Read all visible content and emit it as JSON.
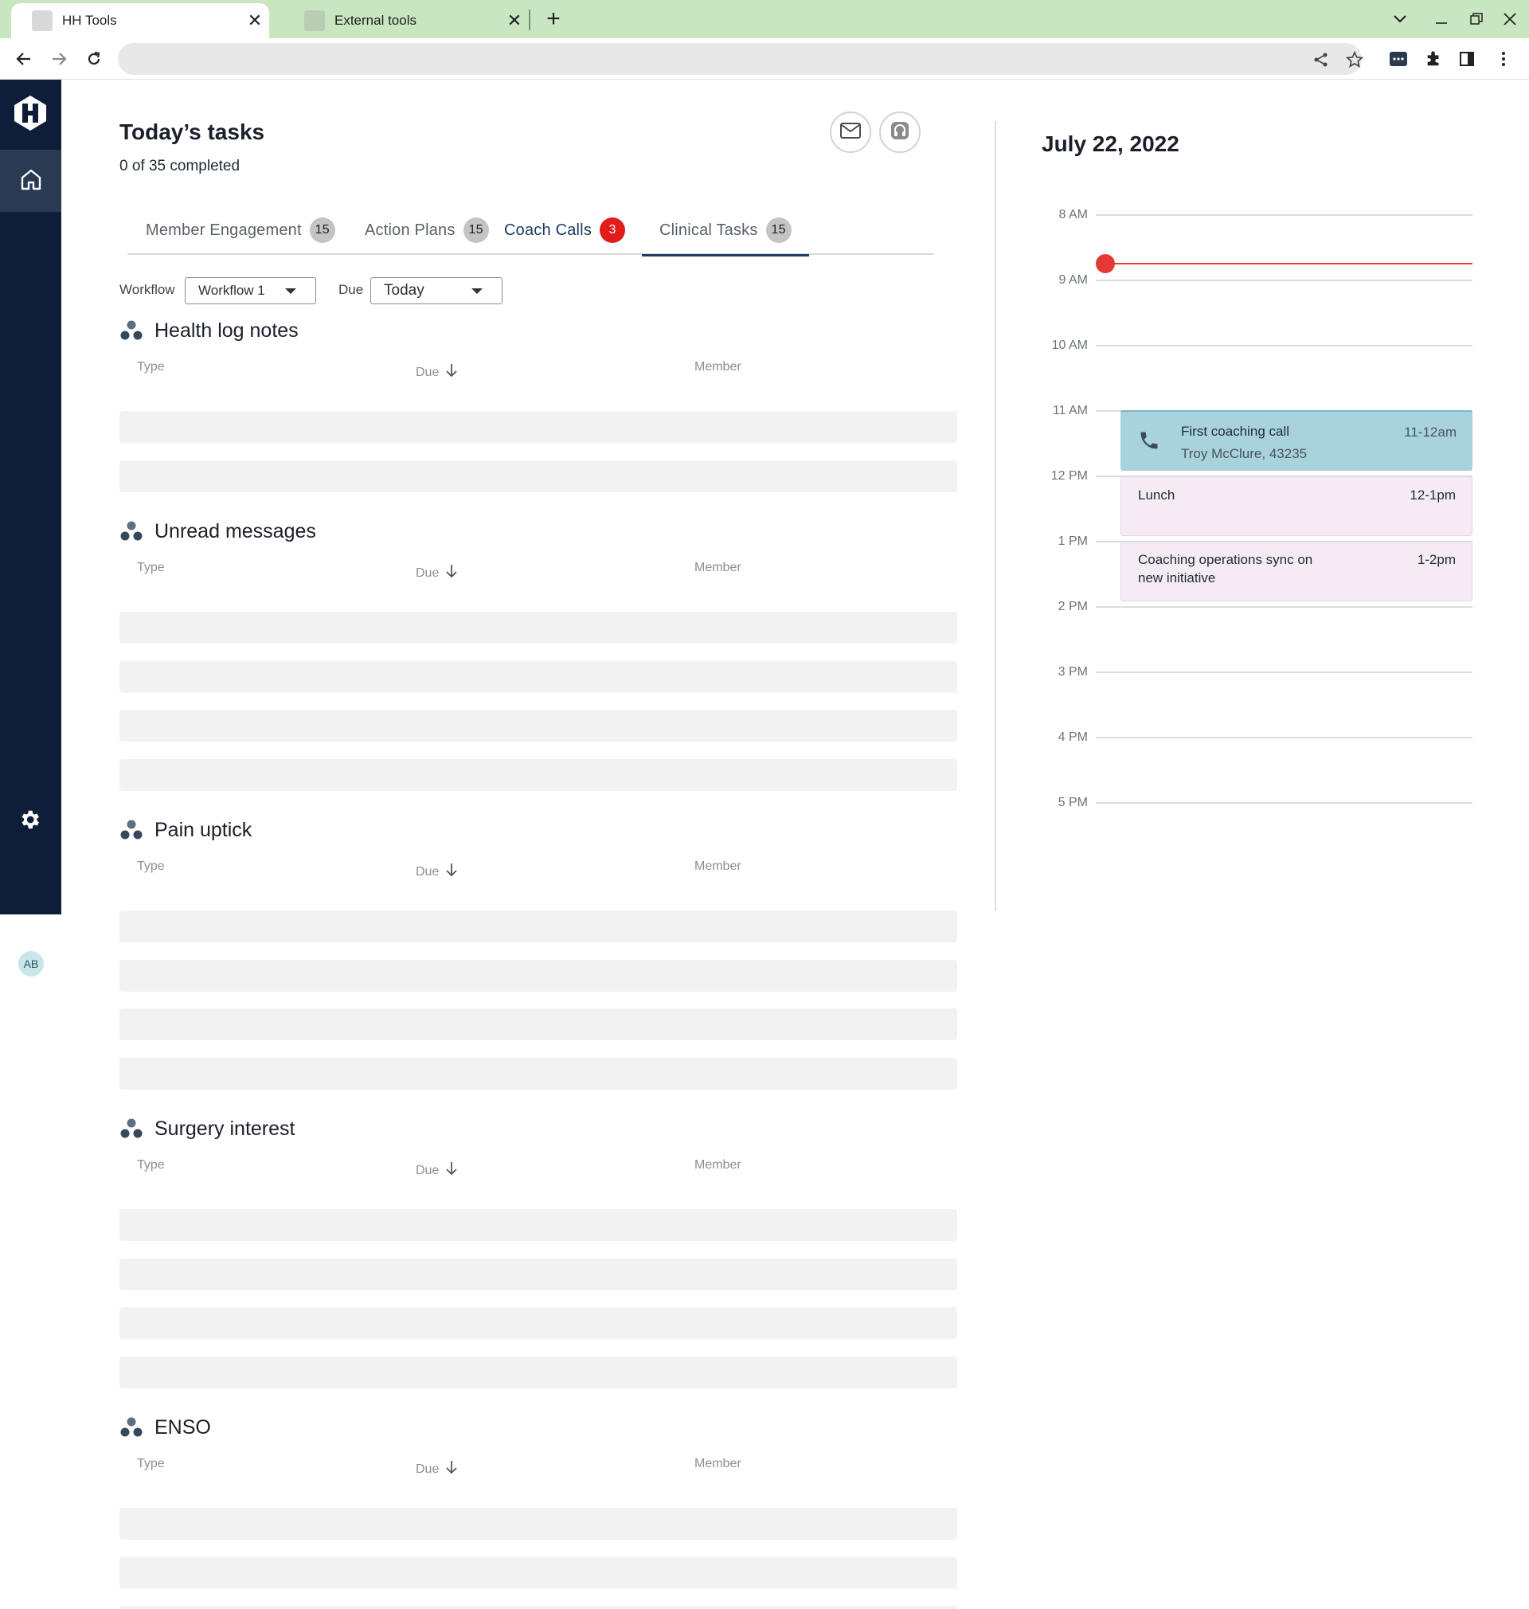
{
  "browser": {
    "tabs": [
      {
        "title": "HH Tools",
        "active": true
      },
      {
        "title": "External tools",
        "active": false
      }
    ]
  },
  "page": {
    "title": "Today’s tasks",
    "progress": "0 of 35 completed"
  },
  "task_tabs": [
    {
      "label": "Member Engagement",
      "count": "15"
    },
    {
      "label": "Action Plans",
      "count": "15"
    },
    {
      "label": "Coach Calls",
      "count": "3"
    },
    {
      "label": "Clinical Tasks",
      "count": "15"
    }
  ],
  "filters": {
    "workflow_label": "Workflow",
    "workflow_value": "Workflow 1",
    "due_label": "Due",
    "due_value": "Today"
  },
  "columns": {
    "type": "Type",
    "due": "Due",
    "member": "Member"
  },
  "sections": [
    {
      "title": "Health log notes",
      "rows": 2
    },
    {
      "title": "Unread messages",
      "rows": 4
    },
    {
      "title": "Pain uptick",
      "rows": 4
    },
    {
      "title": "Surgery interest",
      "rows": 4
    },
    {
      "title": "ENSO",
      "rows": 3
    }
  ],
  "user": {
    "initials": "AB"
  },
  "calendar": {
    "date": "July 22, 2022",
    "hours": [
      "8 AM",
      "9 AM",
      "10 AM",
      "11 AM",
      "12 PM",
      "1 PM",
      "2 PM",
      "3 PM",
      "4 PM",
      "5 PM"
    ],
    "events": [
      {
        "title": "First coaching call",
        "subtitle": "Troy McClure, 43235",
        "time": "11-12am",
        "color": "#a8d3dc"
      },
      {
        "title": "Lunch",
        "time": "12-1pm",
        "color": "#f4ebf5"
      },
      {
        "title_line1": "Coaching operations sync on",
        "title_line2": "new initiative",
        "time": "1-2pm",
        "color": "#f4ebf5"
      }
    ]
  },
  "colors": {
    "sidebar": "#0f1e38",
    "accent": "#1d3a63",
    "alert": "#e21b1b",
    "tabbar": "#c8e6c0"
  }
}
